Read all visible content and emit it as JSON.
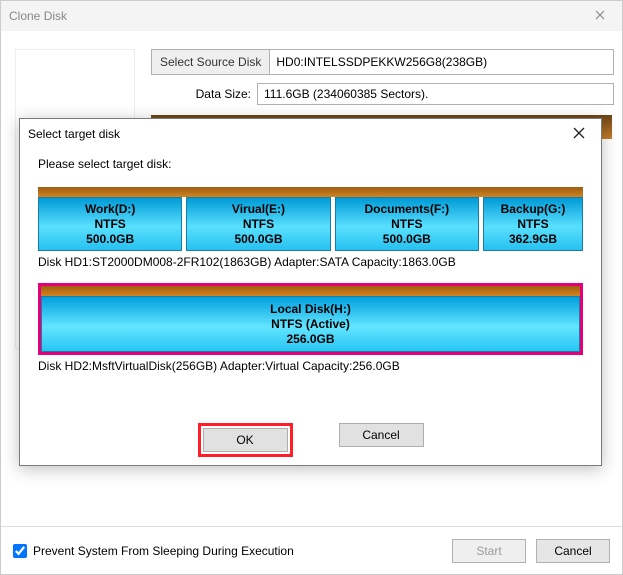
{
  "parent": {
    "title": "Clone Disk",
    "select_source_btn": "Select Source Disk",
    "source_value": "HD0:INTELSSDPEKKW256G8(238GB)",
    "datasize_label": "Data Size:",
    "datasize_value": "111.6GB (234060385 Sectors).",
    "footer_checkbox": "Prevent System From Sleeping During Execution",
    "start_btn": "Start",
    "cancel_btn": "Cancel"
  },
  "modal": {
    "title": "Select target disk",
    "prompt": "Please select target disk:",
    "disk1": {
      "parts": [
        {
          "name": "Work(D:)",
          "fs": "NTFS",
          "size": "500.0GB"
        },
        {
          "name": "Virual(E:)",
          "fs": "NTFS",
          "size": "500.0GB"
        },
        {
          "name": "Documents(F:)",
          "fs": "NTFS",
          "size": "500.0GB"
        },
        {
          "name": "Backup(G:)",
          "fs": "NTFS",
          "size": "362.9GB"
        }
      ],
      "label": "Disk HD1:ST2000DM008-2FR102(1863GB)   Adapter:SATA   Capacity:1863.0GB"
    },
    "disk2": {
      "part": {
        "name": "Local Disk(H:)",
        "fs": "NTFS (Active)",
        "size": "256.0GB"
      },
      "label": "Disk HD2:MsftVirtualDisk(256GB)   Adapter:Virtual   Capacity:256.0GB"
    },
    "ok_btn": "OK",
    "cancel_btn": "Cancel"
  }
}
